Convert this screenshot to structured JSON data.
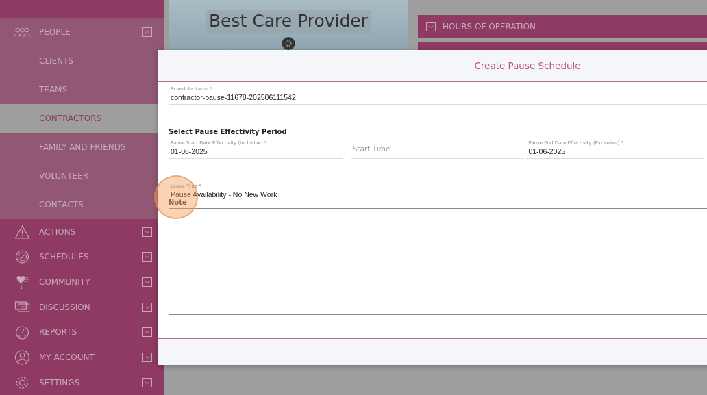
{
  "sidebar": {
    "people": {
      "label": "PEOPLE",
      "expanded": true,
      "children": [
        {
          "label": "CLIENTS",
          "selected": false
        },
        {
          "label": "TEAMS",
          "selected": false
        },
        {
          "label": "CONTRACTORS",
          "selected": true
        },
        {
          "label": "FAMILY AND FRIENDS",
          "selected": false
        },
        {
          "label": "VOLUNTEER",
          "selected": false
        },
        {
          "label": "CONTACTS",
          "selected": false
        }
      ]
    },
    "items": [
      {
        "label": "ACTIONS",
        "expanded": false
      },
      {
        "label": "SCHEDULES",
        "expanded": false
      },
      {
        "label": "COMMUNITY",
        "expanded": false
      },
      {
        "label": "DISCUSSION",
        "expanded": false
      },
      {
        "label": "REPORTS",
        "expanded": false
      },
      {
        "label": "MY ACCOUNT",
        "expanded": false
      },
      {
        "label": "SETTINGS",
        "expanded": false
      }
    ]
  },
  "profile": {
    "title": "Best Care Provider"
  },
  "sections": [
    {
      "title": "HOURS OF OPERATION",
      "expanded": false
    }
  ],
  "dialog": {
    "title": "Create Pause Schedule",
    "schedule_name": {
      "label": "Schedule Name *",
      "value": "contractor-pause-11678-202506111542"
    },
    "period_heading": "Select Pause Effectivity Period",
    "start_date": {
      "label": "Pause Start Date Effectivity (Inclusive) *",
      "value": "01-06-2025"
    },
    "start_time": {
      "placeholder": "Start Time"
    },
    "end_date": {
      "label": "Pause End Date Effectivity (Exclusive) *",
      "value": "01-06-2025"
    },
    "leave_type": {
      "label": "Leave Type *",
      "value": "Pause Availability - No New Work"
    },
    "note": {
      "label": "Note"
    }
  }
}
